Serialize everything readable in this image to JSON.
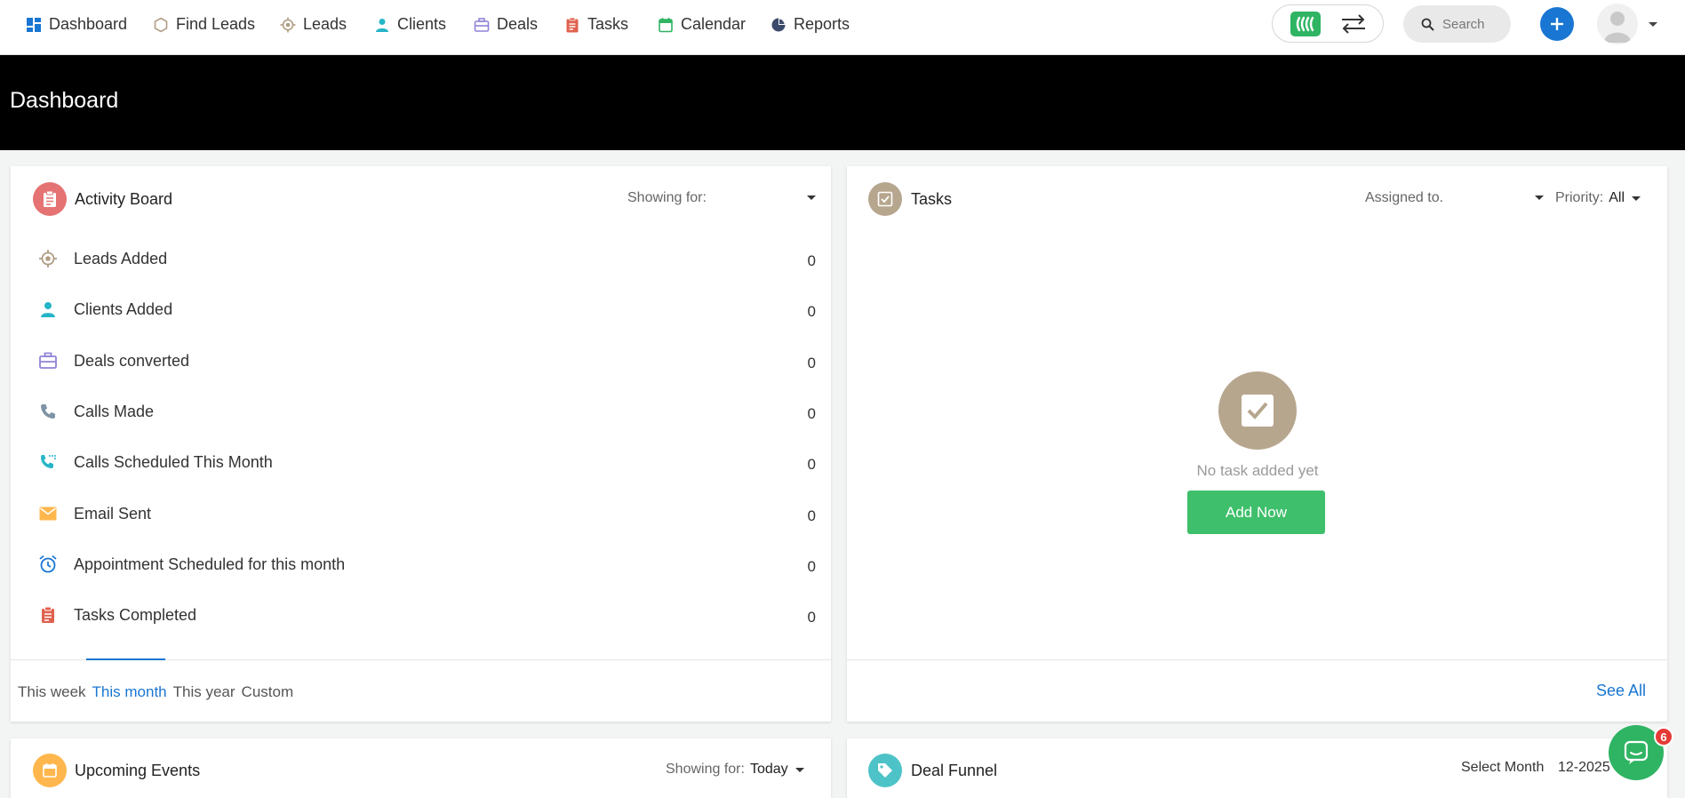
{
  "colors": {
    "primary": "#1976d2",
    "green": "#3ebf6b",
    "banner_bg": "#000000",
    "activity_icon": "#e57373",
    "tasks_icon": "#b7a68e",
    "events_icon": "#ffb74d",
    "funnel_icon": "#4dc3c8"
  },
  "nav": {
    "items": [
      {
        "label": "Dashboard",
        "icon": "grid-icon"
      },
      {
        "label": "Find Leads",
        "icon": "hexagon-icon"
      },
      {
        "label": "Leads",
        "icon": "target-icon"
      },
      {
        "label": "Clients",
        "icon": "person-icon"
      },
      {
        "label": "Deals",
        "icon": "briefcase-icon"
      },
      {
        "label": "Tasks",
        "icon": "clipboard-icon"
      },
      {
        "label": "Calendar",
        "icon": "calendar-icon"
      },
      {
        "label": "Reports",
        "icon": "pie-chart-icon"
      }
    ],
    "search_placeholder": "Search"
  },
  "banner": {
    "title": "Dashboard"
  },
  "activity": {
    "title": "Activity Board",
    "showing_for_label": "Showing for:",
    "rows": [
      {
        "label": "Leads Added",
        "value": "0",
        "icon": "target-icon"
      },
      {
        "label": "Clients Added",
        "value": "0",
        "icon": "person-icon"
      },
      {
        "label": "Deals converted",
        "value": "0",
        "icon": "briefcase-icon"
      },
      {
        "label": "Calls Made",
        "value": "0",
        "icon": "phone-icon"
      },
      {
        "label": "Calls Scheduled This Month",
        "value": "0",
        "icon": "phone-scheduled-icon"
      },
      {
        "label": "Email Sent",
        "value": "0",
        "icon": "envelope-icon"
      },
      {
        "label": "Appointment Scheduled for this month",
        "value": "0",
        "icon": "alarm-clock-icon"
      },
      {
        "label": "Tasks Completed",
        "value": "0",
        "icon": "clipboard-icon"
      }
    ],
    "tabs": [
      "This week",
      "This month",
      "This year",
      "Custom"
    ],
    "active_tab": "This month"
  },
  "tasks": {
    "title": "Tasks",
    "assigned_to_label": "Assigned to.",
    "priority_label": "Priority:",
    "priority_value": "All",
    "empty_text": "No task added yet",
    "add_now_label": "Add Now",
    "see_all_label": "See All"
  },
  "events": {
    "title": "Upcoming Events",
    "showing_for_label": "Showing for:",
    "showing_for_value": "Today"
  },
  "funnel": {
    "title": "Deal Funnel",
    "select_month_label": "Select Month",
    "month_value": "12-2025"
  },
  "chat": {
    "badge_count": "6"
  }
}
